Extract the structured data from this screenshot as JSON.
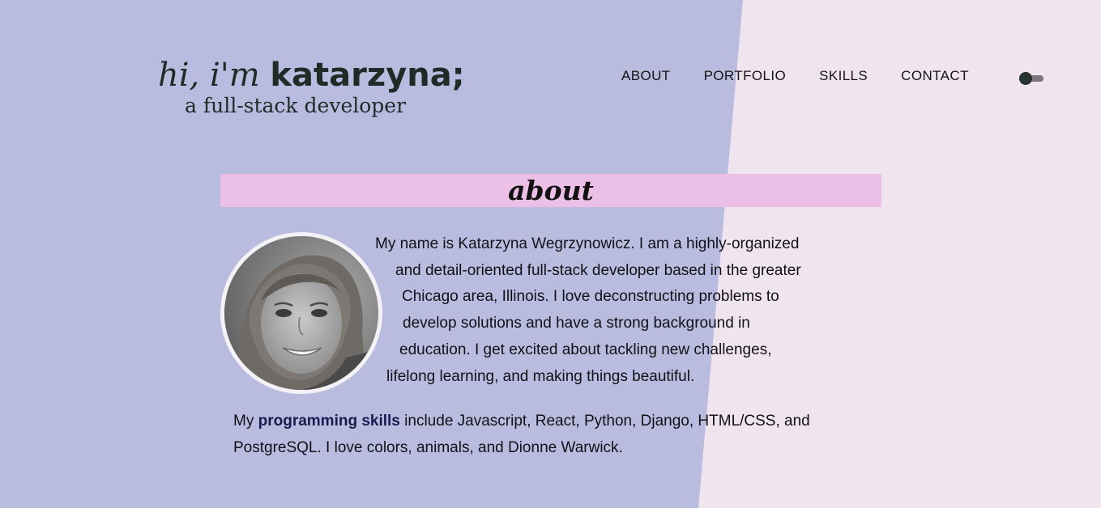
{
  "header": {
    "greeting": "hi, i'm",
    "name": "katarzyna;",
    "tagline": "a full-stack developer"
  },
  "nav": {
    "items": [
      {
        "label": "ABOUT"
      },
      {
        "label": "PORTFOLIO"
      },
      {
        "label": "SKILLS"
      },
      {
        "label": "CONTACT"
      }
    ],
    "theme_toggle_icon": "toggle-switch-icon"
  },
  "about": {
    "title": "about",
    "avatar_icon": "profile-photo",
    "intro_lines": [
      "My name is Katarzyna Wegrzynowicz. I am a highly-organized",
      "and detail-oriented full-stack developer based in the greater",
      "Chicago area, Illinois. I love deconstructing problems to",
      "develop solutions and have a strong background in",
      "education. I get excited about tackling new challenges,",
      "lifelong learning, and making things beautiful."
    ],
    "skills_prefix": "My",
    "skills_emphasis": "programming skills",
    "skills_rest": "include Javascript, React, Python, Django, HTML/CSS, and PostgreSQL. I love colors, animals, and Dionne Warwick."
  },
  "colors": {
    "left_panel": "#b9bbdf",
    "right_panel": "#f0e4ef",
    "title_bar": "#ecbfe6",
    "brand_text": "#1e2b26"
  }
}
